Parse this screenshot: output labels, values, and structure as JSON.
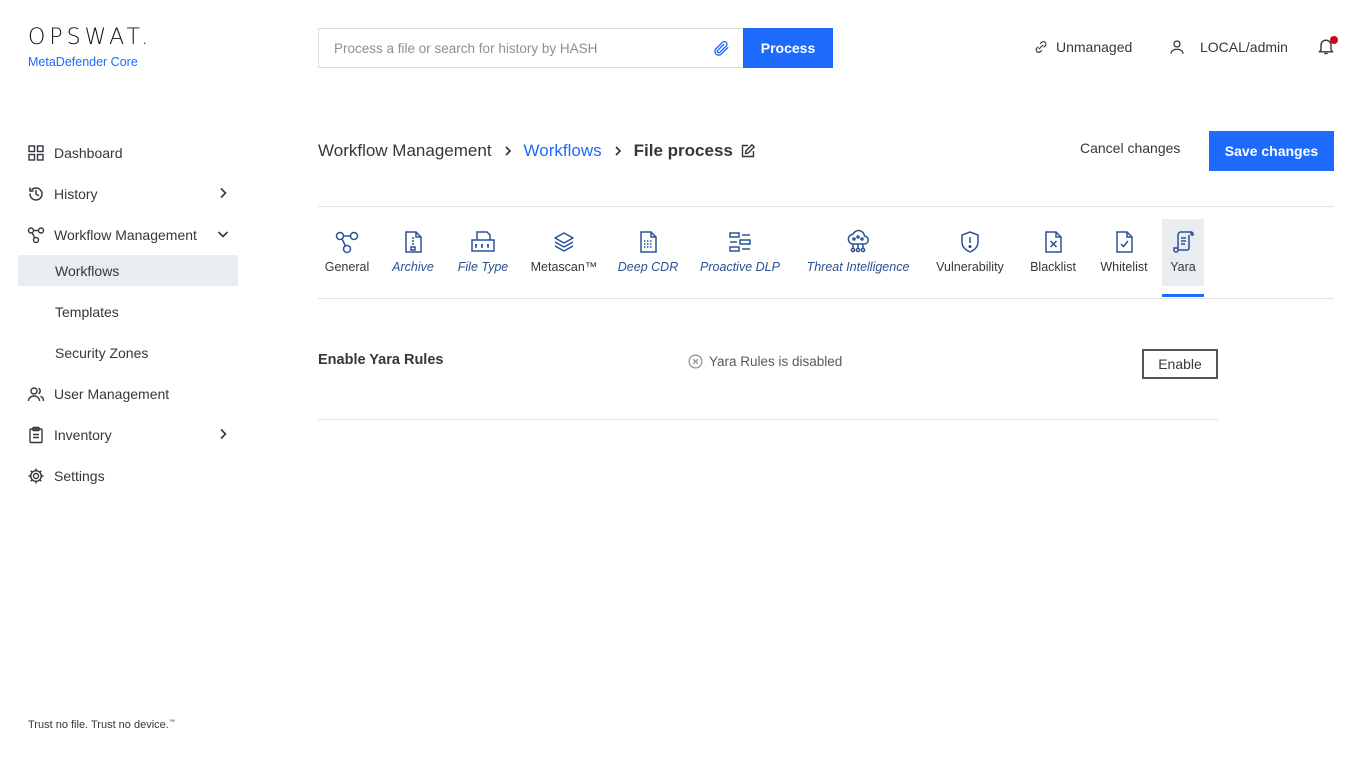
{
  "brand": {
    "logo": "OPSWAT.",
    "product": "MetaDefender Core"
  },
  "search": {
    "placeholder": "Process a file or search for history by HASH",
    "value": "",
    "icon": "paperclip-icon",
    "button_label": "Process"
  },
  "header": {
    "unmanaged_label": "Unmanaged",
    "user_label": "LOCAL/admin",
    "notification_dot_color": "#d0021b"
  },
  "sidebar": {
    "items": [
      {
        "label": "Dashboard",
        "icon": "dashboard-icon"
      },
      {
        "label": "History",
        "icon": "history-icon"
      },
      {
        "label": "Workflow Management",
        "icon": "workflow-icon"
      },
      {
        "label": "Workflows"
      },
      {
        "label": "Templates"
      },
      {
        "label": "Security Zones"
      },
      {
        "label": "User Management",
        "icon": "users-icon"
      },
      {
        "label": "Inventory",
        "icon": "clipboard-icon"
      },
      {
        "label": "Settings",
        "icon": "gear-icon"
      }
    ],
    "tagline": "Trust no file. Trust no device.",
    "tagline_mark": "™"
  },
  "breadcrumb": {
    "level1": "Workflow Management",
    "level2": "Workflows",
    "level3": "File process"
  },
  "actions": {
    "cancel_label": "Cancel changes",
    "save_label": "Save changes"
  },
  "tabs": [
    {
      "label": "General",
      "icon": "general-icon"
    },
    {
      "label": "Archive",
      "icon": "archive-icon"
    },
    {
      "label": "File Type",
      "icon": "file-type-icon"
    },
    {
      "label": "Metascan™",
      "icon": "metascan-icon"
    },
    {
      "label": "Deep CDR",
      "icon": "deep-cdr-icon"
    },
    {
      "label": "Proactive DLP",
      "icon": "proactive-dlp-icon"
    },
    {
      "label": "Threat Intelligence",
      "icon": "threat-intelligence-icon"
    },
    {
      "label": "Vulnerability",
      "icon": "vulnerability-icon"
    },
    {
      "label": "Blacklist",
      "icon": "blacklist-icon"
    },
    {
      "label": "Whitelist",
      "icon": "whitelist-icon"
    },
    {
      "label": "Yara",
      "icon": "yara-icon"
    }
  ],
  "yara": {
    "title": "Enable Yara Rules",
    "status_text": "Yara Rules is disabled",
    "button_label": "Enable"
  },
  "colors": {
    "accent": "#1d6bfc",
    "italic_tab": "#2a5293"
  }
}
